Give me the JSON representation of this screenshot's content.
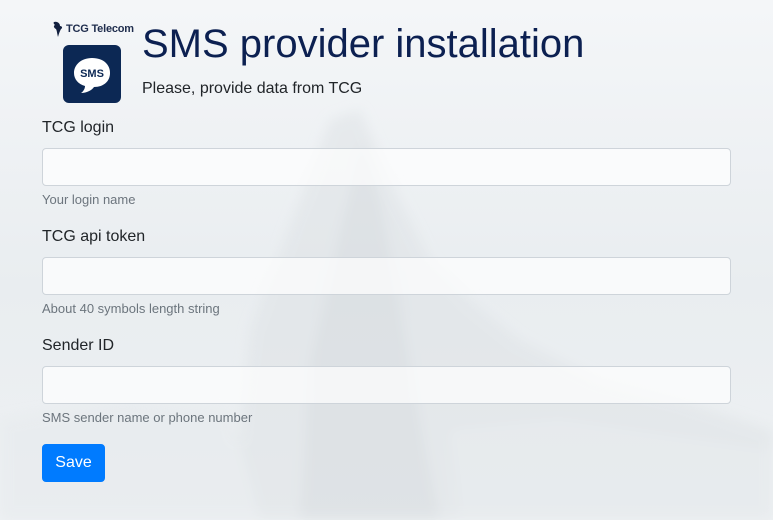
{
  "header": {
    "brand_name": "TCG Telecom",
    "sms_icon_text": "SMS",
    "title": "SMS provider installation",
    "subtitle": "Please, provide data from TCG"
  },
  "form": {
    "login": {
      "label": "TCG login",
      "value": "",
      "help": "Your login name"
    },
    "api_token": {
      "label": "TCG api token",
      "value": "",
      "help": "About 40 symbols length string"
    },
    "sender_id": {
      "label": "Sender ID",
      "value": "",
      "help": "SMS sender name or phone number"
    },
    "save_label": "Save"
  },
  "colors": {
    "title": "#0c2051",
    "icon_tile": "#0c2854",
    "primary_button": "#007bff",
    "help_text": "#6c757d"
  }
}
